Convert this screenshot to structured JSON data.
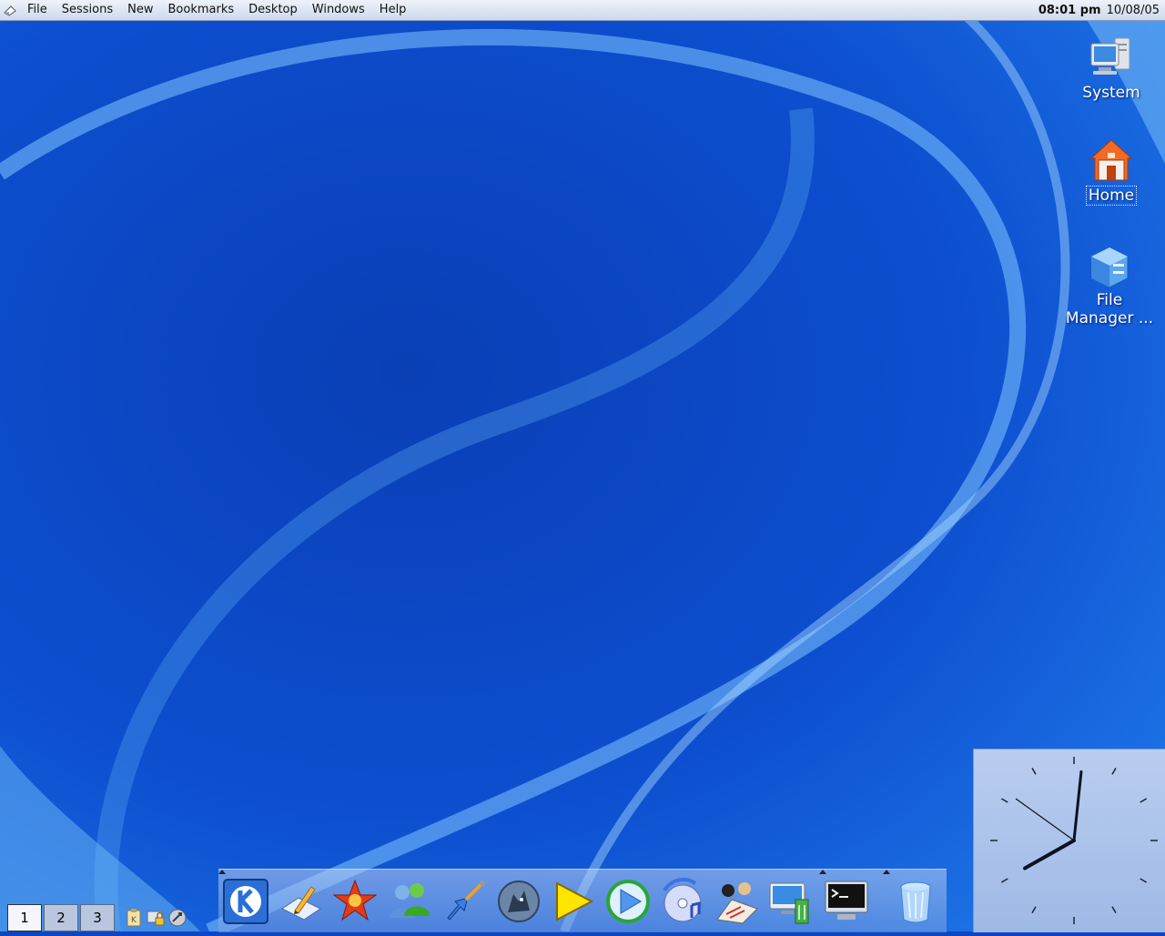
{
  "menubar": {
    "items": [
      "File",
      "Sessions",
      "New",
      "Bookmarks",
      "Desktop",
      "Windows",
      "Help"
    ],
    "time": "08:01 pm",
    "date": "10/08/05"
  },
  "desktop_icons": {
    "system": {
      "label": "System",
      "icon": "computer-icon"
    },
    "home": {
      "label": "Home",
      "icon": "home-folder-icon"
    },
    "file_manager": {
      "label_line1": "File",
      "label_line2": "Manager ...",
      "icon": "file-manager-cube-icon"
    }
  },
  "pager": {
    "desktops": [
      "1",
      "2",
      "3"
    ],
    "active_index": 0
  },
  "dock": {
    "items": [
      "kde-k-menu-icon",
      "text-editor-icon",
      "star-icon",
      "users-icon",
      "guitar-icon",
      "wolf-icon",
      "yellow-play-icon",
      "media-player-icon",
      "cd-music-icon",
      "people-chat-icon",
      "monitor-network-icon",
      "terminal-icon",
      "trash-can-icon"
    ]
  },
  "clock": {
    "hour": 8,
    "minute": 1
  },
  "colors": {
    "wallpaper_blue": "#0d46c4",
    "menubar_top": "#eef2fa",
    "dock_tint": "#9ab8ea"
  }
}
